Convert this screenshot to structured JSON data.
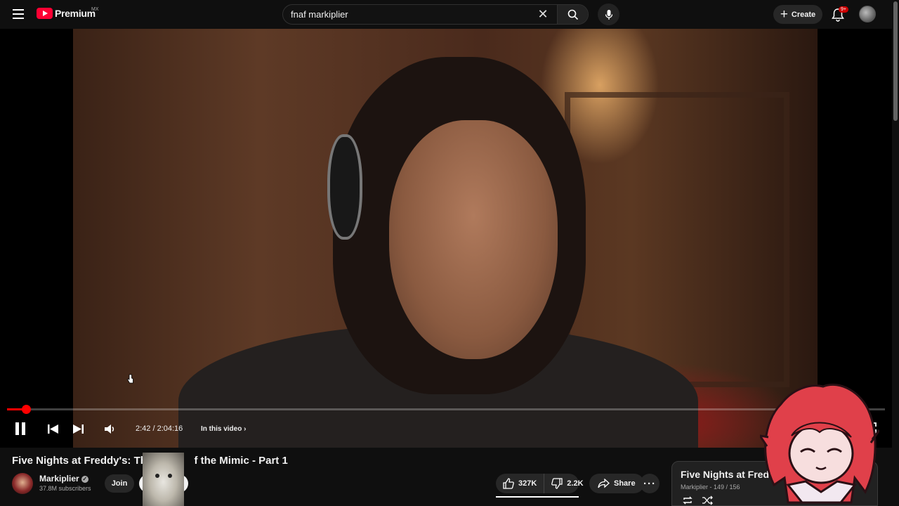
{
  "header": {
    "logo_text": "Premium",
    "country_code": "MX",
    "search_value": "fnaf markiplier",
    "create_label": "Create",
    "notification_badge": "9+"
  },
  "player": {
    "current_time": "2:42",
    "duration": "2:04:16",
    "time_display": "2:42 / 2:04:16",
    "progress_fraction": 0.0217,
    "chapter_label": "In this video"
  },
  "video": {
    "title": "Five Nights at Freddy's: The S",
    "title_suffix": "f the Mimic - Part 1"
  },
  "channel": {
    "name": "Markiplier",
    "subscribers": "37.8M subscribers",
    "join_label": "Join"
  },
  "actions": {
    "likes": "327K",
    "dislikes": "2.2K",
    "share_label": "Share"
  },
  "playlist": {
    "title": "Five Nights at Freddy",
    "meta": "Markiplier - 149 / 156"
  },
  "colors": {
    "accent": "#ff0000",
    "brand": "#ff0033",
    "background": "#0f0f0f"
  }
}
